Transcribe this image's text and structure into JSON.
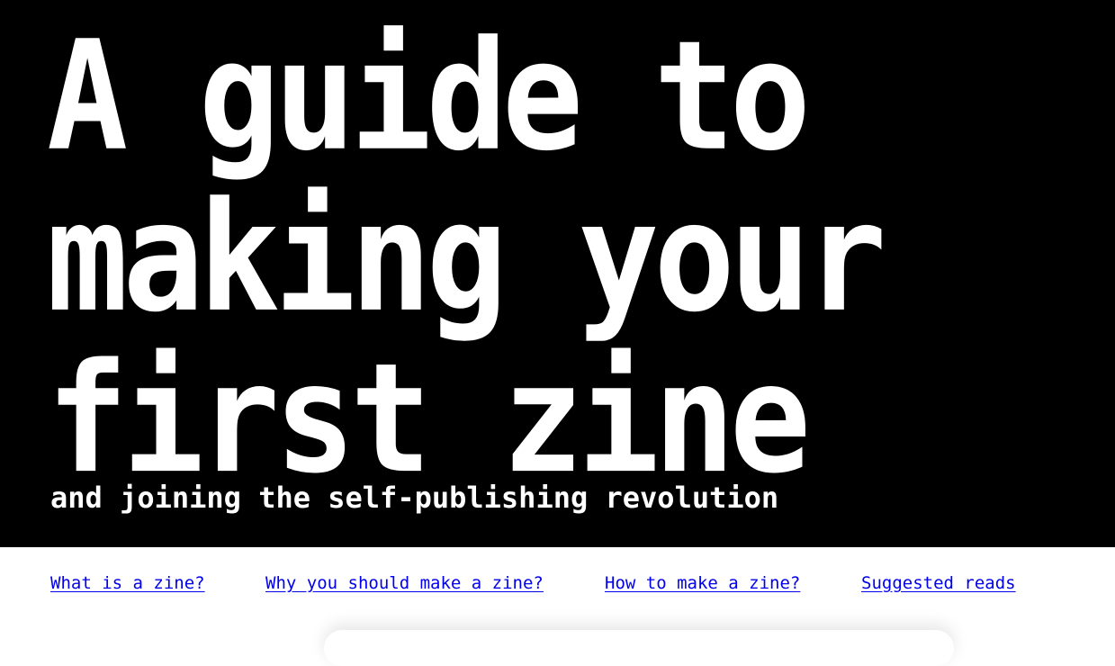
{
  "hero": {
    "title_lines": [
      "A guide to",
      "making your",
      "first zine"
    ],
    "subtitle": "and joining the self-publishing revolution",
    "background_color": "#000000",
    "text_color": "#ffffff"
  },
  "nav": {
    "links": [
      {
        "label": "What is a zine?"
      },
      {
        "label": "Why you should make a zine?"
      },
      {
        "label": "How to make a zine?"
      },
      {
        "label": "Suggested reads"
      }
    ],
    "link_color": "#0000ee"
  }
}
